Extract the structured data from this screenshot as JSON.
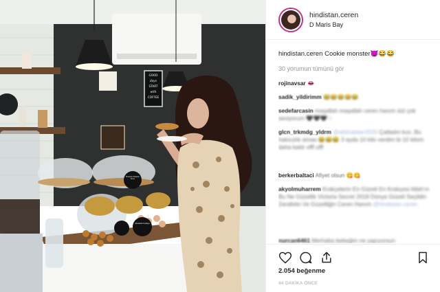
{
  "post": {
    "username": "hindistan.ceren",
    "location": "D Maris Bay",
    "caption_user": "hindistan.ceren",
    "caption_text": "Cookie monster😈😂😂",
    "view_all_comments": "30 yorumun tümünü gör",
    "likes": "2.054 beğenme",
    "time_ago": "44 DAKİKA ÖNCE"
  },
  "comments": [
    {
      "user": "rojinavsar",
      "text": "👄"
    },
    {
      "user": "sadik_yildirimm",
      "text": "😂😂😂😂😂"
    },
    {
      "user": "sedefarcasin",
      "text": "maşallah maşallah ceren hanım sizi çok seviyorum 🖤🖤🖤♡"
    },
    {
      "user": "glcn_trkmdg_yldrm",
      "mention": "@alishabber2020",
      "text": "Çatladın kızı. Bu haksızlık amaa 😂😂😂 3 ayda 10 kilo verdim bi 10 kilom daha kaldı offf ufff"
    },
    {
      "user": "berkerbaltaci",
      "text": "Afiyet olsun 😋😋"
    },
    {
      "user": "akyolmuharrem",
      "text": "Krakçelerin En Güzeli En Kralıçesi Allah'ın Bu Ne Güzellik Victoria Secret 2018 Dünya Güzeli Seçildin Zerafetin Ve Güzelliğin Ceren Hanım",
      "mention": "@hindistan.ceren"
    },
    {
      "user": "nurcan6461",
      "text": "Merhaba bebeğim ne yapıyorsun"
    }
  ],
  "scene": {
    "sign_good_days": [
      "GOOD",
      "days",
      "START",
      "with",
      "COFFEE"
    ],
    "cake_tag": "Brownie Kakaolu Krem",
    "cafe_plate": "Çikolatalı Kurabiye"
  },
  "icons": [
    "heart-icon",
    "comment-icon",
    "share-icon",
    "bookmark-icon"
  ],
  "colors": {
    "avatar_ring": "#c13584",
    "mention": "#9fb4d8"
  }
}
